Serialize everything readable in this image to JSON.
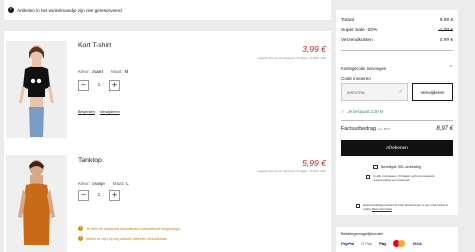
{
  "notice": {
    "text": "Artikelen in het winkelmandje zijn niet gereserveerd"
  },
  "cart_items": [
    {
      "name": "Kort T-shirt",
      "price": "3,99 €",
      "subline": "Laagste prijs van de afgelopen 30 dagen: 13,99 €  -20%",
      "color_label": "Kleur:",
      "color_value": "zwart",
      "size_label": "Maat:",
      "size_value": "M",
      "quantity": "1",
      "links": [
        "Bewerken",
        "Verwijderen"
      ]
    },
    {
      "name": "Tanktop",
      "price": "5,99 €",
      "subline": "Laagste prijs van de afgelopen 30 dagen: 19,99 €  -20%",
      "color_label": "Kleur:",
      "color_value": "oranje",
      "size_label": "Maat:",
      "size_value": "L",
      "quantity": "1",
      "warnings": [
        "Je hebt de maximaal beschikbare hoeveelheid toegevoegd.",
        "Alleen er zijn) bij nog artikele artikelen beschikbaar"
      ]
    }
  ],
  "summary": {
    "total_label": "Totaal",
    "total_value": "9,98 €",
    "sale_label": "Super Sale -20%",
    "sale_value": "-2,00 €",
    "shipping_label": "Verzendkosten",
    "shipping_value": "0,99 €",
    "discount_toggle": "Kortingscode toevoegen",
    "code_label": "Code invoeren",
    "code_value": "20EXTRA",
    "apply_label": "Verwijderen",
    "saved_text": "Je bespaart 2,00 €!",
    "invoice_label": "Factuurbedrag",
    "invoice_vat": "incl. BTW",
    "invoice_value": "8,97 €",
    "checkout_label": "Afrekenen",
    "secure_text": "Beveiligde SSL-verbinding",
    "delivery_text": "In alle t uit passen: 30 dagen recht op kosteloze retourzending van producten",
    "return_text": "Retourzendingen kosten € 0,00. Retourneren in een C&A winkel is gratis.",
    "return_link": "Meer informatie"
  },
  "payment": {
    "title": "Betalingsmogelijkheden",
    "methods": [
      "PayPal",
      "G Pay",
      "Pay",
      "VISA"
    ]
  },
  "colors": {
    "price": "#c0262b",
    "saved": "#2e8b57",
    "warning": "#c57c10",
    "button": "#111111"
  }
}
